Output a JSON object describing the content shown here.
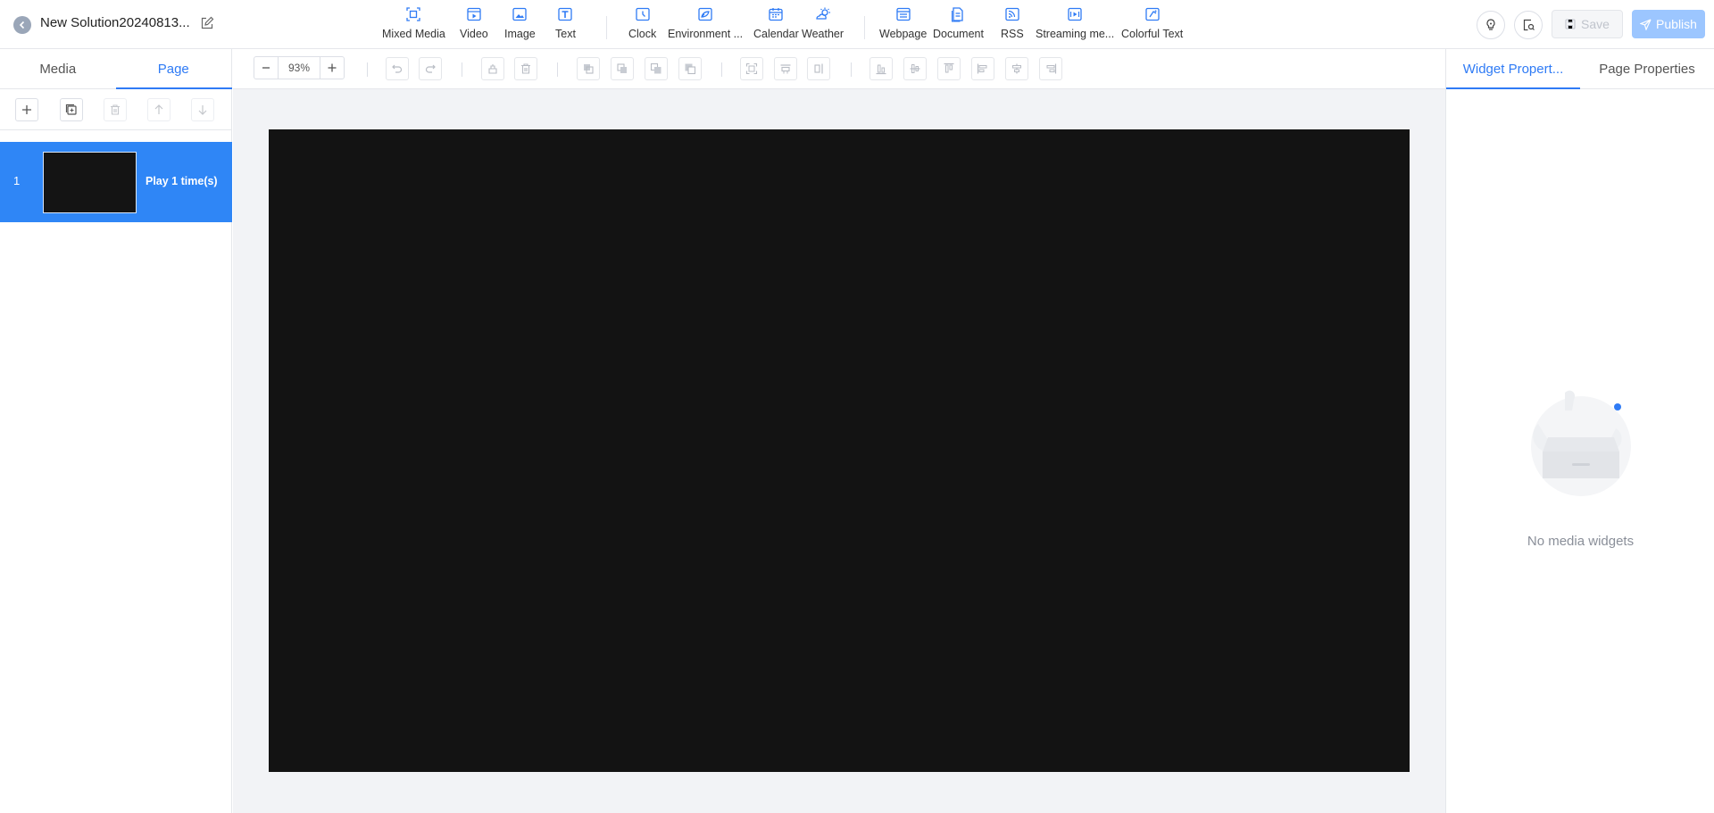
{
  "header": {
    "title": "New Solution20240813...",
    "save_label": "Save",
    "publish_label": "Publish"
  },
  "widgets": [
    {
      "label": "Mixed Media",
      "icon": "mixed-media-icon"
    },
    {
      "label": "Video",
      "icon": "video-icon"
    },
    {
      "label": "Image",
      "icon": "image-icon"
    },
    {
      "label": "Text",
      "icon": "text-icon"
    },
    {
      "label": "Clock",
      "icon": "clock-icon"
    },
    {
      "label": "Environment ...",
      "icon": "environment-icon"
    },
    {
      "label": "Calendar",
      "icon": "calendar-icon"
    },
    {
      "label": "Weather",
      "icon": "weather-icon"
    },
    {
      "label": "Webpage",
      "icon": "webpage-icon"
    },
    {
      "label": "Document",
      "icon": "document-icon"
    },
    {
      "label": "RSS",
      "icon": "rss-icon"
    },
    {
      "label": "Streaming me...",
      "icon": "streaming-media-icon"
    },
    {
      "label": "Colorful Text",
      "icon": "colorful-text-icon"
    }
  ],
  "left_tabs": {
    "media": "Media",
    "page": "Page"
  },
  "pages": [
    {
      "number": "1",
      "label": "Play 1 time(s)"
    }
  ],
  "zoom": {
    "value": "93%"
  },
  "right_tabs": {
    "widget": "Widget Propert...",
    "page": "Page Properties"
  },
  "empty_state": {
    "text": "No media widgets"
  },
  "colors": {
    "accent": "#2f7bf5",
    "selected_page": "#2f86f6",
    "canvas": "#131313",
    "publish": "#9cc6ff"
  }
}
